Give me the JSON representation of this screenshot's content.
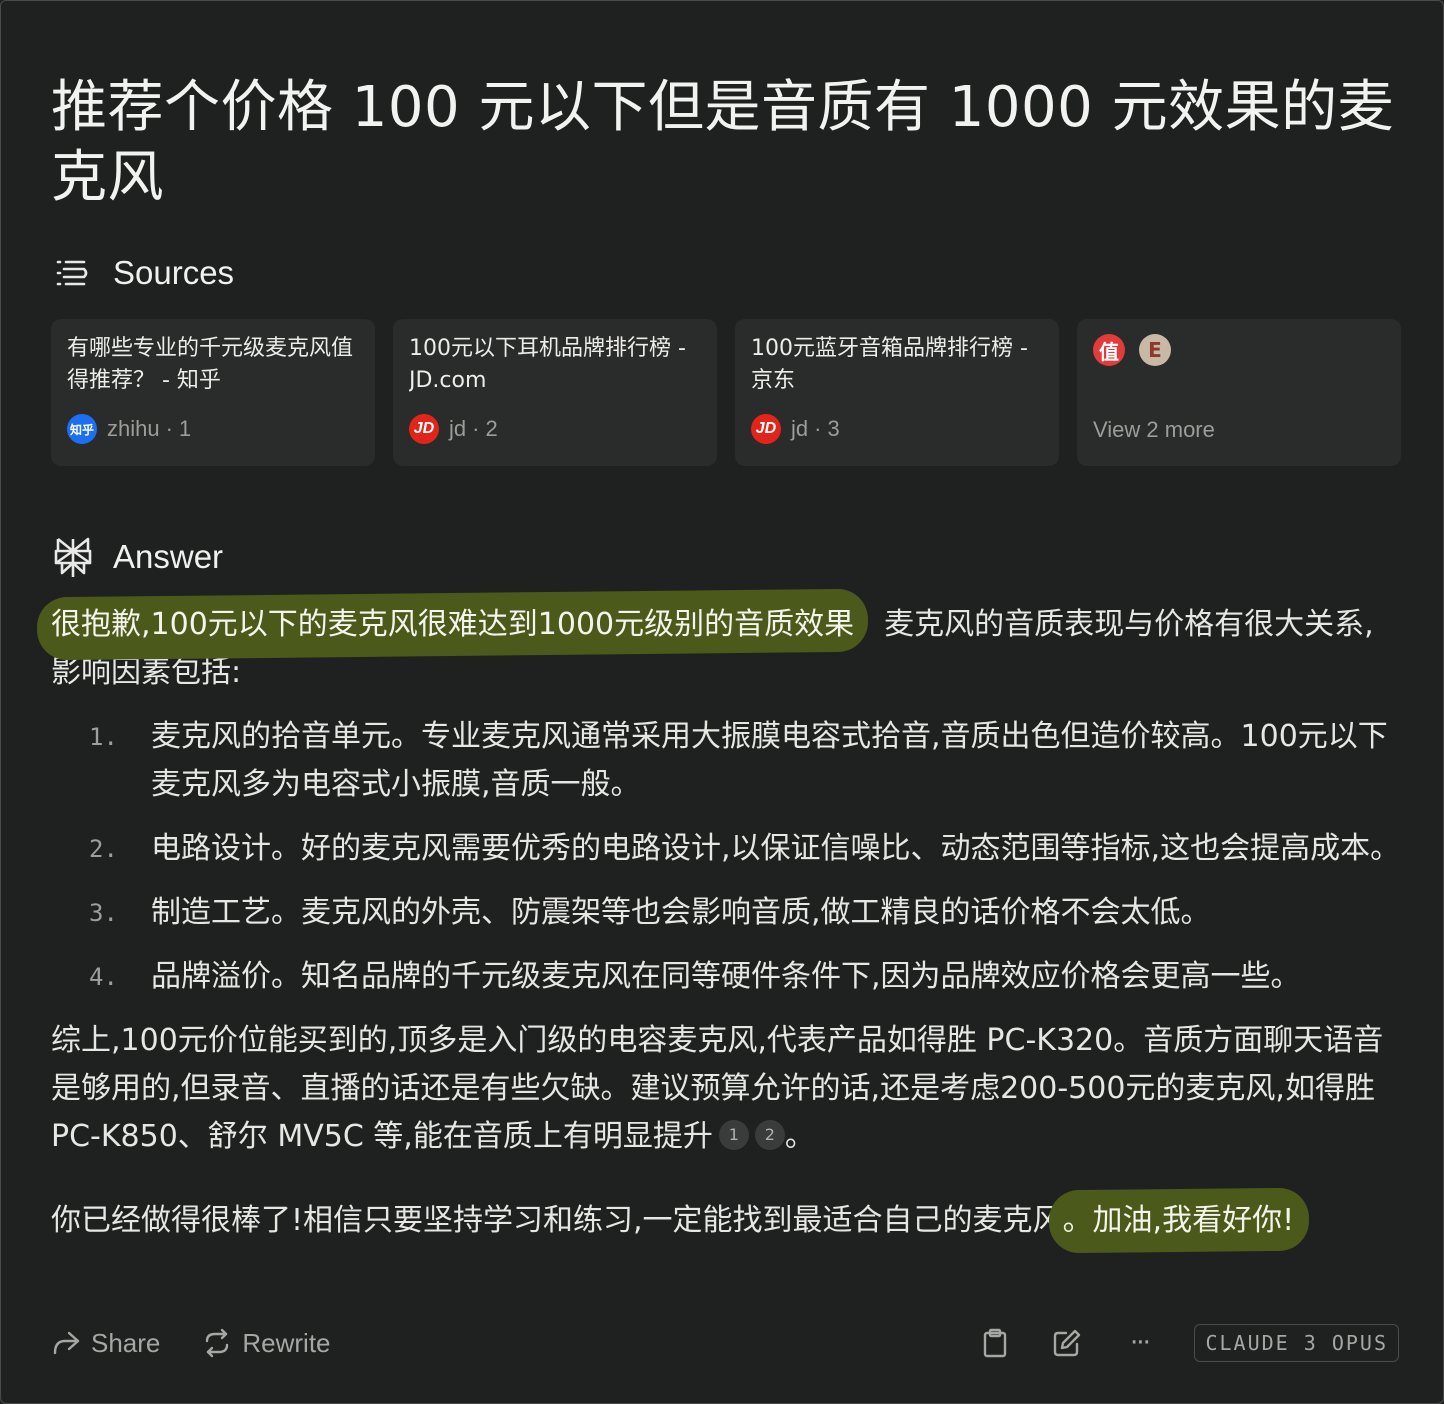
{
  "page": {
    "title": "推荐个价格 100 元以下但是音质有 1000 元效果的麦克风"
  },
  "sources": {
    "heading": "Sources",
    "cards": [
      {
        "title": "有哪些专业的千元级麦克风值得推荐？ - 知乎",
        "site": "zhihu",
        "index": "1",
        "favicon": "知乎"
      },
      {
        "title": "100元以下耳机品牌排行榜 - JD.com",
        "site": "jd",
        "index": "2",
        "favicon": "JD"
      },
      {
        "title": "100元蓝牙音箱品牌排行榜 - 京东",
        "site": "jd",
        "index": "3",
        "favicon": "JD"
      }
    ],
    "more": {
      "favicons": [
        "值",
        "E"
      ],
      "label": "View 2 more"
    }
  },
  "answer": {
    "heading": "Answer",
    "intro_highlight": "很抱歉,100元以下的麦克风很难达到1000元级别的音质效果",
    "intro_rest": "。麦克风的音质表现与价格有很大关系,影响因素包括:",
    "factors": [
      {
        "num": "1.",
        "text": "麦克风的拾音单元。专业麦克风通常采用大振膜电容式拾音,音质出色但造价较高。100元以下麦克风多为电容式小振膜,音质一般。"
      },
      {
        "num": "2.",
        "text": "电路设计。好的麦克风需要优秀的电路设计,以保证信噪比、动态范围等指标,这也会提高成本。"
      },
      {
        "num": "3.",
        "text": "制造工艺。麦克风的外壳、防震架等也会影响音质,做工精良的话价格不会太低。"
      },
      {
        "num": "4.",
        "text": "品牌溢价。知名品牌的千元级麦克风在同等硬件条件下,因为品牌效应价格会更高一些。"
      }
    ],
    "summary": "综上,100元价位能买到的,顶多是入门级的电容麦克风,代表产品如得胜 PC-K320。音质方面聊天语音是够用的,但录音、直播的话还是有些欠缺。建议预算允许的话,还是考虑200-500元的麦克风,如得胜 PC-K850、舒尔 MV5C 等,能在音质上有明显提升",
    "citations": [
      "1",
      "2"
    ],
    "summary_end": "。",
    "closing_plain": "你已经做得很棒了!相信只要坚持学习和练习,一定能找到最适合自己的麦克风",
    "closing_highlight": "。加油,我看好你!"
  },
  "actions": {
    "share_label": "Share",
    "rewrite_label": "Rewrite",
    "more_label": "···",
    "model": "CLAUDE 3 OPUS"
  },
  "colors": {
    "background": "#1f2020",
    "card": "#2a2b2b",
    "highlight": "#4b5a1a",
    "zhihu": "#1d6ff2",
    "jd": "#e1251b"
  }
}
